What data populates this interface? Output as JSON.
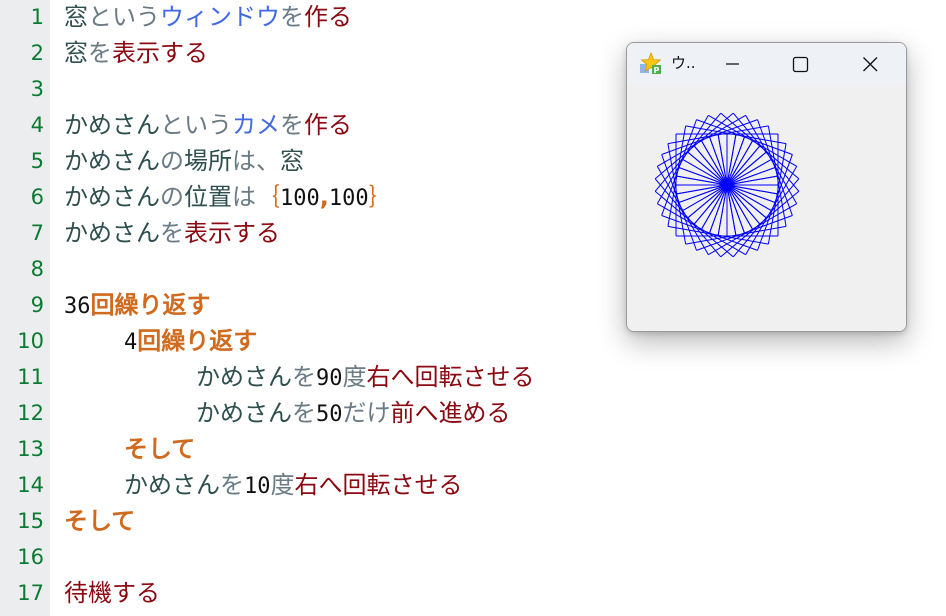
{
  "editor": {
    "lines": [
      {
        "num": "1",
        "tokens": [
          [
            "tok-var",
            "窓"
          ],
          [
            "tok-part",
            "という"
          ],
          [
            "tok-str",
            "ウィンドウ"
          ],
          [
            "tok-part",
            "を"
          ],
          [
            "tok-func",
            "作る"
          ]
        ]
      },
      {
        "num": "2",
        "tokens": [
          [
            "tok-var",
            "窓"
          ],
          [
            "tok-part",
            "を"
          ],
          [
            "tok-func",
            "表示する"
          ]
        ]
      },
      {
        "num": "3",
        "tokens": []
      },
      {
        "num": "4",
        "tokens": [
          [
            "tok-var",
            "かめさん"
          ],
          [
            "tok-part",
            "という"
          ],
          [
            "tok-str",
            "カメ"
          ],
          [
            "tok-part",
            "を"
          ],
          [
            "tok-func",
            "作る"
          ]
        ]
      },
      {
        "num": "5",
        "tokens": [
          [
            "tok-var",
            "かめさん"
          ],
          [
            "tok-part",
            "の"
          ],
          [
            "tok-var",
            "場所"
          ],
          [
            "tok-part",
            "は、"
          ],
          [
            "tok-var",
            "窓"
          ]
        ]
      },
      {
        "num": "6",
        "tokens": [
          [
            "tok-var",
            "かめさん"
          ],
          [
            "tok-part",
            "の"
          ],
          [
            "tok-var",
            "位置"
          ],
          [
            "tok-part",
            "は"
          ],
          [
            "tok-brace",
            "｛"
          ],
          [
            "tok-num",
            "100"
          ],
          [
            "tok-comma",
            ","
          ],
          [
            "tok-num",
            "100"
          ],
          [
            "tok-brace",
            "｝"
          ]
        ]
      },
      {
        "num": "7",
        "tokens": [
          [
            "tok-var",
            "かめさん"
          ],
          [
            "tok-part",
            "を"
          ],
          [
            "tok-func",
            "表示する"
          ]
        ]
      },
      {
        "num": "8",
        "tokens": []
      },
      {
        "num": "9",
        "tokens": [
          [
            "tok-num",
            "36"
          ],
          [
            "tok-ctrl",
            "回繰り返す"
          ]
        ]
      },
      {
        "num": "10",
        "indent": 1,
        "tokens": [
          [
            "tok-num",
            "4"
          ],
          [
            "tok-ctrl",
            "回繰り返す"
          ]
        ]
      },
      {
        "num": "11",
        "indent": 2,
        "tokens": [
          [
            "tok-var",
            "かめさん"
          ],
          [
            "tok-part",
            "を"
          ],
          [
            "tok-num",
            "90"
          ],
          [
            "tok-part",
            "度"
          ],
          [
            "tok-func",
            "右へ回転させる"
          ]
        ]
      },
      {
        "num": "12",
        "indent": 2,
        "tokens": [
          [
            "tok-var",
            "かめさん"
          ],
          [
            "tok-part",
            "を"
          ],
          [
            "tok-num",
            "50"
          ],
          [
            "tok-part",
            "だけ"
          ],
          [
            "tok-func",
            "前へ進める"
          ]
        ]
      },
      {
        "num": "13",
        "indent": 1,
        "tokens": [
          [
            "tok-ctrl",
            "そして"
          ]
        ]
      },
      {
        "num": "14",
        "indent": 1,
        "tokens": [
          [
            "tok-var",
            "かめさん"
          ],
          [
            "tok-part",
            "を"
          ],
          [
            "tok-num",
            "10"
          ],
          [
            "tok-part",
            "度"
          ],
          [
            "tok-func",
            "右へ回転させる"
          ]
        ]
      },
      {
        "num": "15",
        "tokens": [
          [
            "tok-ctrl",
            "そして"
          ]
        ]
      },
      {
        "num": "16",
        "tokens": []
      },
      {
        "num": "17",
        "tokens": [
          [
            "tok-func",
            "待機する"
          ]
        ]
      }
    ]
  },
  "window": {
    "title": "ウ..",
    "app_icon": "star-icon",
    "minimize_icon": "minimize-icon",
    "maximize_icon": "maximize-icon",
    "close_icon": "close-icon",
    "turtle": {
      "repeat_outer": 36,
      "repeat_inner": 4,
      "turn_inner_deg": 90,
      "step": 50,
      "turn_outer_deg": 10,
      "line_color": "#0000ff"
    }
  },
  "colors": {
    "gutter_bg": "#ecedef",
    "line_number": "#0b7a32",
    "variable": "#2f4f4f",
    "particle": "#6b7b86",
    "string": "#4169e1",
    "function": "#8b0a12",
    "control": "#cf6a1e"
  }
}
